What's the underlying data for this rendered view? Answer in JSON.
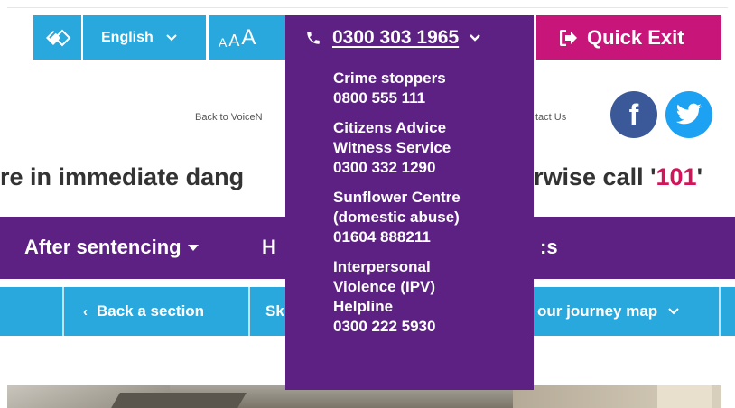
{
  "toolbar": {
    "accessibility_icon": "accessibility-icon",
    "language": "English",
    "text_size": [
      "A",
      "A",
      "A"
    ],
    "phone": "0300 303 1965",
    "quick_exit": "Quick Exit"
  },
  "links": {
    "back": "Back to VoiceN",
    "contact": "tact Us"
  },
  "social": {
    "facebook_label": "f",
    "twitter_icon": "twitter-icon"
  },
  "banner": {
    "left_text": "re in immediate dang",
    "right_text": "rwise call '",
    "emphasis": "101",
    "right_end": "'"
  },
  "nav": {
    "item1": "After sentencing",
    "item2": "H",
    "item3": ":s"
  },
  "subnav": {
    "back_section": "Back a section",
    "skip": "Sk",
    "journey": "our journey map"
  },
  "dropdown": {
    "entries": [
      {
        "lines": [
          "Crime stoppers",
          "0800 555 111"
        ]
      },
      {
        "lines": [
          "Citizens Advice",
          "Witness Service",
          "0300 332 1290"
        ]
      },
      {
        "lines": [
          "Sunflower Centre",
          "(domestic abuse)",
          "01604 888211"
        ]
      },
      {
        "lines": [
          "Interpersonal",
          "Violence (IPV)",
          "Helpline",
          "0300 222 5930"
        ]
      }
    ]
  },
  "colors": {
    "blue": "#29a8dd",
    "purple": "#5c2182",
    "pink": "#c8157a",
    "accent_101": "#d4145a"
  }
}
